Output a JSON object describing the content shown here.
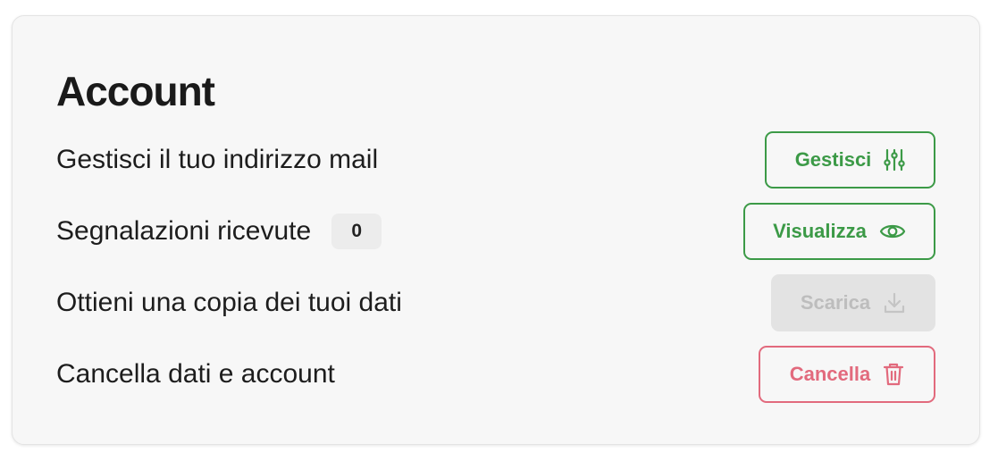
{
  "section": {
    "title": "Account"
  },
  "rows": [
    {
      "label": "Gestisci il tuo indirizzo mail",
      "button": {
        "label": "Gestisci",
        "icon": "sliders-icon",
        "state": "enabled",
        "color": "#3c9a47"
      }
    },
    {
      "label": "Segnalazioni ricevute",
      "badge": "0",
      "button": {
        "label": "Visualizza",
        "icon": "eye-icon",
        "state": "enabled",
        "color": "#3c9a47"
      }
    },
    {
      "label": "Ottieni una copia dei tuoi dati",
      "button": {
        "label": "Scarica",
        "icon": "download-icon",
        "state": "disabled",
        "color": "#bdbdbd"
      }
    },
    {
      "label": "Cancella dati e account",
      "button": {
        "label": "Cancella",
        "icon": "trash-icon",
        "state": "enabled",
        "color": "#e26a7d"
      }
    }
  ]
}
